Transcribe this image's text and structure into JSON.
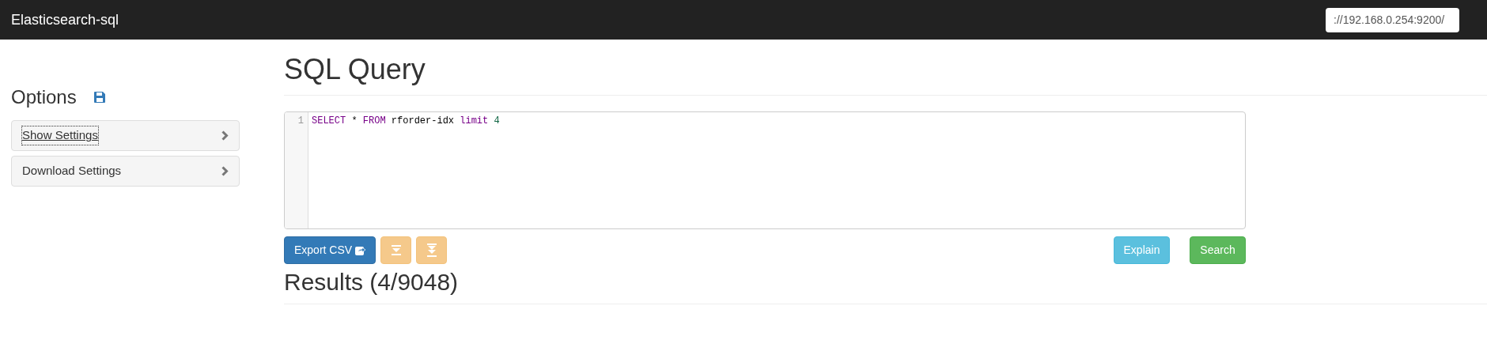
{
  "navbar": {
    "brand": "Elasticsearch-sql",
    "url_field": {
      "value": "://192.168.0.254:9200/"
    }
  },
  "sidebar": {
    "title": "Options",
    "items": [
      {
        "label": "Show Settings",
        "focused": true
      },
      {
        "label": "Download Settings",
        "focused": false
      }
    ]
  },
  "main": {
    "title": "SQL Query",
    "editor": {
      "lines": [
        {
          "number": "1",
          "tokens": [
            {
              "text": "SELECT",
              "kind": "keyword"
            },
            {
              "text": " * ",
              "kind": "plain"
            },
            {
              "text": "FROM",
              "kind": "keyword"
            },
            {
              "text": " rforder-idx ",
              "kind": "plain"
            },
            {
              "text": "limit",
              "kind": "keyword"
            },
            {
              "text": " 4",
              "kind": "number"
            }
          ]
        }
      ]
    },
    "left_buttons": [
      {
        "kind": "export",
        "label": "Export CSV",
        "disabled": false
      },
      {
        "kind": "step",
        "disabled": true
      },
      {
        "kind": "all",
        "disabled": true
      }
    ],
    "right_buttons": [
      {
        "kind": "info",
        "label": "Explain"
      },
      {
        "kind": "success",
        "label": "Search"
      }
    ],
    "results_title": "Results (4/9048)"
  }
}
